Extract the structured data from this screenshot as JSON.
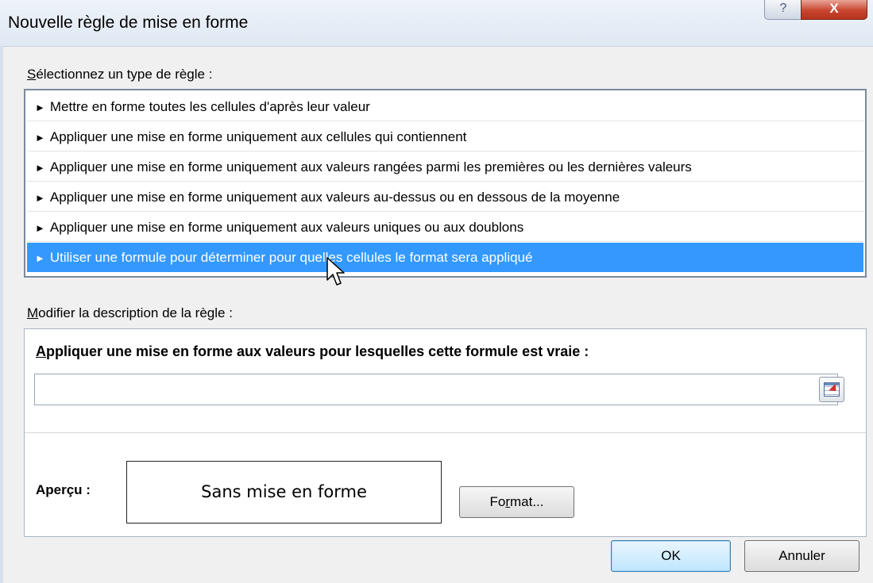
{
  "window": {
    "title": "Nouvelle règle de mise en forme",
    "help_label": "?",
    "close_label": "X"
  },
  "rule_type": {
    "label_first": "S",
    "label_rest": "électionnez un type de règle :",
    "items": [
      {
        "label": "Mettre en forme toutes les cellules d'après leur valeur",
        "selected": false
      },
      {
        "label": "Appliquer une mise en forme uniquement aux cellules qui contiennent",
        "selected": false
      },
      {
        "label": "Appliquer une mise en forme uniquement aux valeurs rangées parmi les premières ou les dernières valeurs",
        "selected": false
      },
      {
        "label": "Appliquer une mise en forme uniquement aux valeurs au-dessus ou en dessous de la moyenne",
        "selected": false
      },
      {
        "label": "Appliquer une mise en forme uniquement aux valeurs uniques ou aux doublons",
        "selected": false
      },
      {
        "label": "Utiliser une formule pour déterminer pour quelles cellules le format sera appliqué",
        "selected": true
      }
    ],
    "bullet": "►"
  },
  "description": {
    "label_first": "M",
    "label_rest": "odifier la description de la règle :",
    "heading_first": "A",
    "heading_rest": "ppliquer une mise en forme aux valeurs pour lesquelles cette formule est vraie :",
    "formula_value": "",
    "preview_label": "Aperçu :",
    "preview_text": "Sans mise en forme",
    "format_button_first": "F",
    "format_button_second": "o",
    "format_button_underlined": "r",
    "format_button_rest": "mat..."
  },
  "buttons": {
    "ok": "OK",
    "cancel": "Annuler"
  },
  "colors": {
    "selection": "#3399ff",
    "ok_border": "#3c7fb1"
  }
}
